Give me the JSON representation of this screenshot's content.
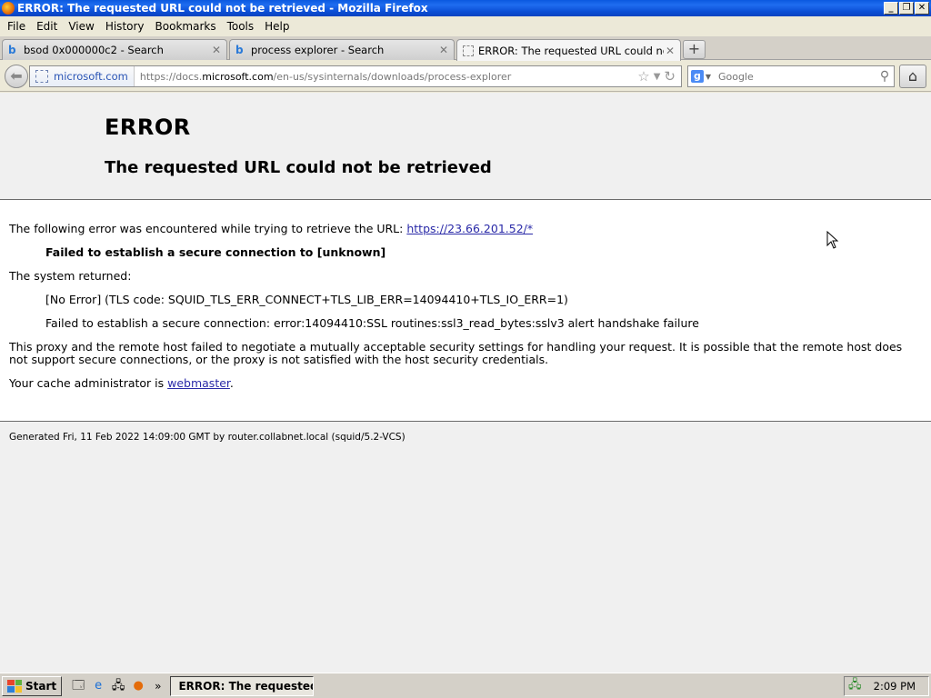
{
  "window": {
    "title": "ERROR: The requested URL could not be retrieved - Mozilla Firefox"
  },
  "menu": [
    "File",
    "Edit",
    "View",
    "History",
    "Bookmarks",
    "Tools",
    "Help"
  ],
  "tabs": [
    {
      "label": "bsod 0x000000c2 - Search",
      "icon": "bing-icon"
    },
    {
      "label": "process explorer - Search",
      "icon": "bing-icon"
    },
    {
      "label": "ERROR: The requested URL could not be...",
      "icon": "blank-page-icon"
    }
  ],
  "nav": {
    "site_identity": "microsoft.com",
    "url_prefix": "https://docs.",
    "url_domain": "microsoft.com",
    "url_path": "/en-us/sysinternals/downloads/process-explorer",
    "search_placeholder": "Google"
  },
  "page": {
    "heading": "ERROR",
    "subheading": "The requested URL could not be retrieved",
    "intro": "The following error was encountered while trying to retrieve the URL: ",
    "intro_link": "https://23.66.201.52/*",
    "failure": "Failed to establish a secure connection to [unknown]",
    "system_returned": "The system returned:",
    "tls_code": "[No Error] (TLS code: SQUID_TLS_ERR_CONNECT+TLS_LIB_ERR=14094410+TLS_IO_ERR=1)",
    "ssl_error": "Failed to establish a secure connection: error:14094410:SSL routines:ssl3_read_bytes:sslv3 alert handshake failure",
    "explanation": "This proxy and the remote host failed to negotiate a mutually acceptable security settings for handling your request. It is possible that the remote host does not support secure connections, or the proxy is not satisfied with the host security credentials.",
    "admin_prefix": "Your cache administrator is ",
    "admin_link": "webmaster",
    "admin_suffix": ".",
    "generated": "Generated Fri, 11 Feb 2022 14:09:00 GMT by router.collabnet.local (squid/5.2-VCS)"
  },
  "taskbar": {
    "start_label": "Start",
    "task_label": "ERROR: The requested...",
    "clock": "2:09 PM"
  }
}
